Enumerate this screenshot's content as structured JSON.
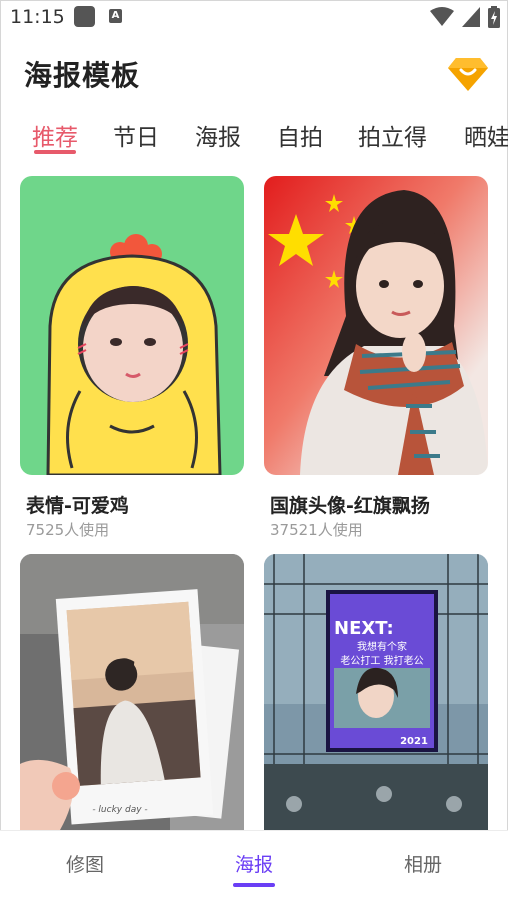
{
  "status": {
    "time": "11:15"
  },
  "header": {
    "title": "海报模板"
  },
  "tabs": [
    {
      "label": "推荐"
    },
    {
      "label": "节日"
    },
    {
      "label": "海报"
    },
    {
      "label": "自拍"
    },
    {
      "label": "拍立得"
    },
    {
      "label": "晒娃"
    }
  ],
  "active_tab": "推荐",
  "cards": [
    {
      "title": "表情-可爱鸡",
      "usage": "7525人使用"
    },
    {
      "title": "国旗头像-红旗飘扬",
      "usage": "37521人使用"
    },
    {
      "title": "",
      "usage": "",
      "caption": "- lucky day -"
    },
    {
      "title": "",
      "usage": "",
      "poster": {
        "headline": "NEXT:",
        "line1": "我想有个家",
        "line2": "老公打工 我打老公",
        "year": "2021"
      }
    }
  ],
  "bottom_nav": [
    {
      "label": "修图"
    },
    {
      "label": "海报"
    },
    {
      "label": "相册"
    }
  ],
  "active_nav": "海报",
  "colors": {
    "accent_tab": "#e75a6b",
    "accent_nav": "#6a3ef5",
    "vip_badge": "#f5a300"
  }
}
